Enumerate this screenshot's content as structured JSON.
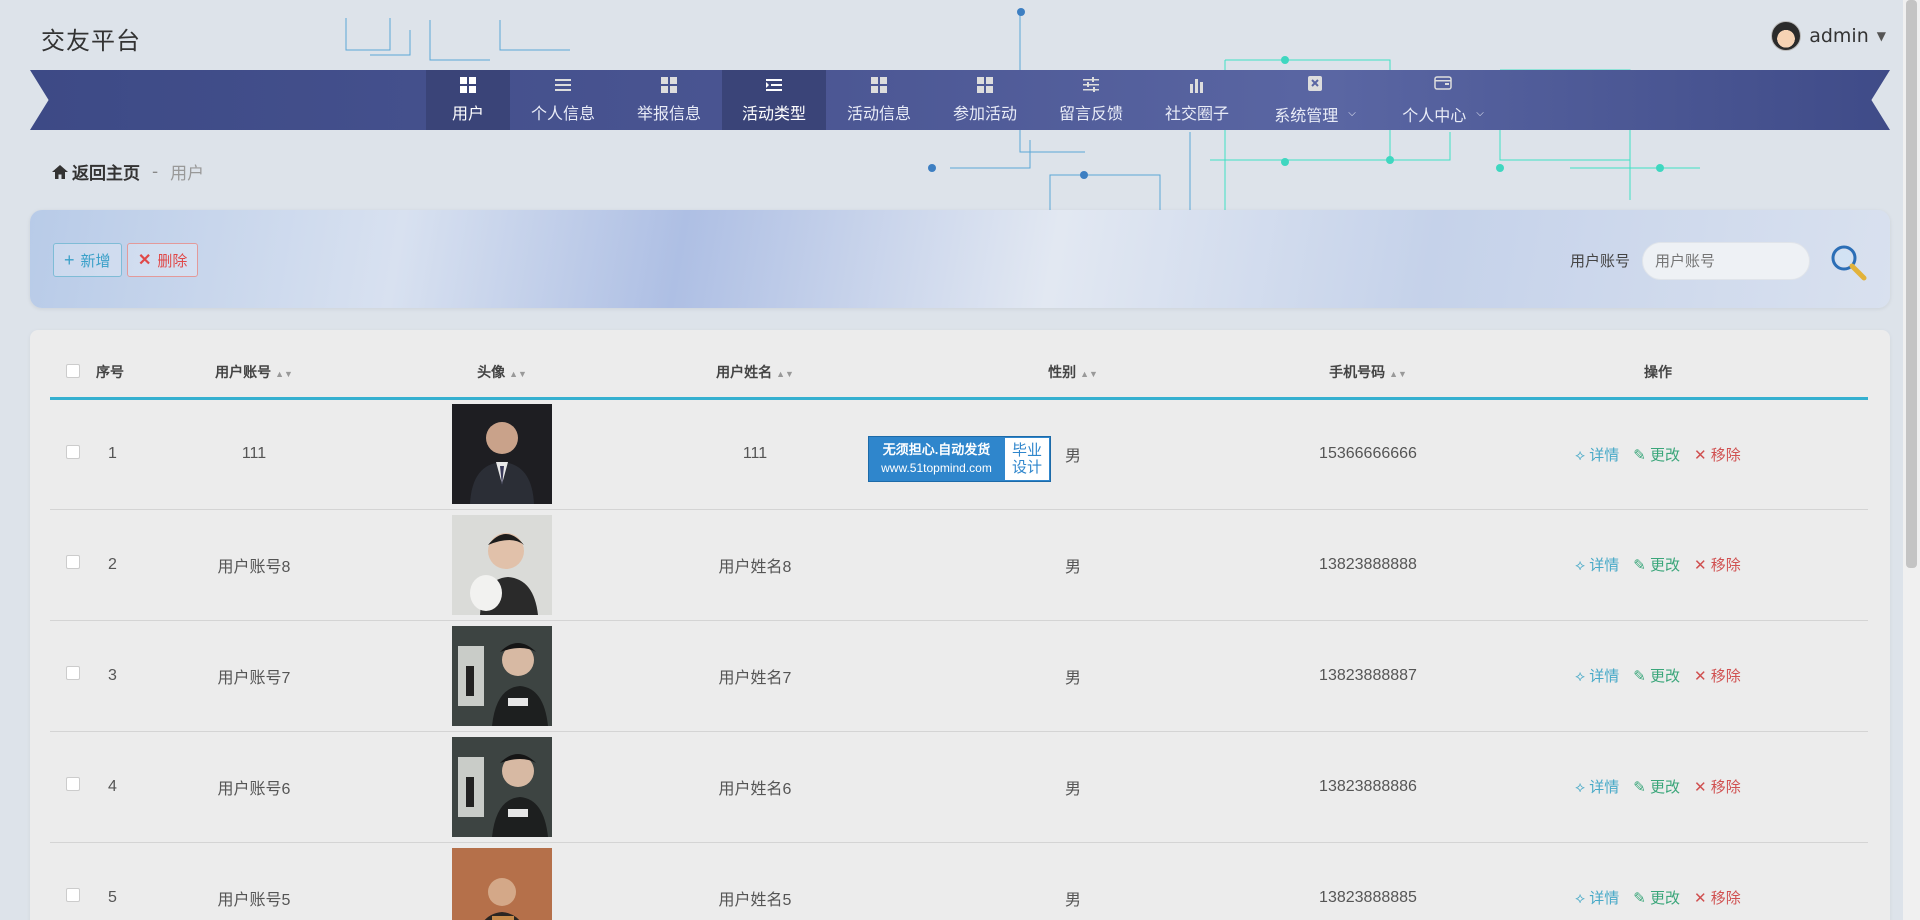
{
  "header": {
    "site_title": "交友平台",
    "user_name": "admin"
  },
  "nav": {
    "items": [
      {
        "label": "用户",
        "icon": "grid-icon",
        "active": true
      },
      {
        "label": "个人信息",
        "icon": "list-icon"
      },
      {
        "label": "举报信息",
        "icon": "grid-icon"
      },
      {
        "label": "活动类型",
        "icon": "indent-icon"
      },
      {
        "label": "活动信息",
        "icon": "grid-icon"
      },
      {
        "label": "参加活动",
        "icon": "grid-icon"
      },
      {
        "label": "留言反馈",
        "icon": "sliders-icon"
      },
      {
        "label": "社交圈子",
        "icon": "bar-chart-icon"
      },
      {
        "label": "系统管理",
        "icon": "clipboard-icon",
        "dropdown": true
      },
      {
        "label": "个人中心",
        "icon": "wallet-icon",
        "dropdown": true
      }
    ]
  },
  "breadcrumb": {
    "home": "返回主页",
    "separator": "-",
    "current": "用户"
  },
  "toolbar": {
    "add_label": "新增",
    "delete_label": "删除",
    "search_label": "用户账号",
    "search_placeholder": "用户账号"
  },
  "table": {
    "headers": [
      "序号",
      "用户账号",
      "头像",
      "用户姓名",
      "性别",
      "手机号码",
      "操作"
    ],
    "rows": [
      {
        "index": "1",
        "account": "111",
        "name": "111",
        "gender": "男",
        "phone": "15366666666"
      },
      {
        "index": "2",
        "account": "用户账号8",
        "name": "用户姓名8",
        "gender": "男",
        "phone": "13823888888"
      },
      {
        "index": "3",
        "account": "用户账号7",
        "name": "用户姓名7",
        "gender": "男",
        "phone": "13823888887"
      },
      {
        "index": "4",
        "account": "用户账号6",
        "name": "用户姓名6",
        "gender": "男",
        "phone": "13823888886"
      },
      {
        "index": "5",
        "account": "用户账号5",
        "name": "用户姓名5",
        "gender": "男",
        "phone": "13823888885"
      }
    ],
    "ops": {
      "detail": "详情",
      "edit": "更改",
      "remove": "移除"
    }
  },
  "watermark": {
    "line1": "无须担心.自动发货",
    "line2": "www.51topmind.com",
    "badge1": "毕业",
    "badge2": "设计"
  },
  "colors": {
    "nav_bg": "#4a5592",
    "nav_active": "#3a4478",
    "table_accent": "#35b0d0",
    "op_detail": "#47a9c7",
    "op_edit": "#3aa67a",
    "op_remove": "#d05050"
  }
}
